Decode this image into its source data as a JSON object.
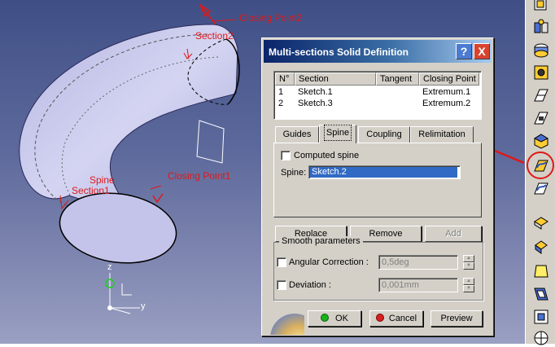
{
  "scene": {
    "labels": {
      "closing_point2": "Closing Point2",
      "section2": "Section2",
      "spine": "Spine",
      "section1": "Section1",
      "closing_point1": "Closing Point1"
    },
    "axes": {
      "z": "z",
      "y": "y"
    },
    "colors": {
      "background_top": "#3f4f86",
      "background_bottom": "#9aa0c2",
      "solid": "#c8c8ec",
      "annotation": "#e01818"
    }
  },
  "dialog": {
    "title": "Multi-sections Solid Definition",
    "help_label": "?",
    "close_label": "X",
    "table": {
      "headers": [
        "N°",
        "Section",
        "Tangent",
        "Closing Point"
      ],
      "rows": [
        {
          "n": "1",
          "section": "Sketch.1",
          "tangent": "",
          "closing_point": "Extremum.1"
        },
        {
          "n": "2",
          "section": "Sketch.3",
          "tangent": "",
          "closing_point": "Extremum.2"
        }
      ]
    },
    "tabs": [
      "Guides",
      "Spine",
      "Coupling",
      "Relimitation"
    ],
    "active_tab": "Spine",
    "spine_tab": {
      "computed_spine_label": "Computed spine",
      "spine_label": "Spine:",
      "spine_value": "Sketch.2"
    },
    "actions": {
      "replace": "Replace",
      "remove": "Remove",
      "add": "Add"
    },
    "smooth": {
      "legend": "Smooth parameters",
      "angular_label": "Angular Correction :",
      "angular_value": "0,5deg",
      "deviation_label": "Deviation :",
      "deviation_value": "0,001mm"
    },
    "buttons": {
      "ok": "OK",
      "cancel": "Cancel",
      "preview": "Preview"
    }
  },
  "toolbar": {
    "icons": [
      "pad-icon",
      "shaft-icon",
      "groove-icon",
      "hole-icon",
      "rib-icon",
      "slot-icon",
      "stiffener-icon",
      "multi-sections-solid-icon",
      "removed-multi-sections-icon",
      "fillet-icon",
      "chamfer-icon",
      "draft-icon",
      "shell-icon",
      "thickness-icon",
      "thread-icon"
    ],
    "highlighted": "multi-sections-solid-icon"
  }
}
